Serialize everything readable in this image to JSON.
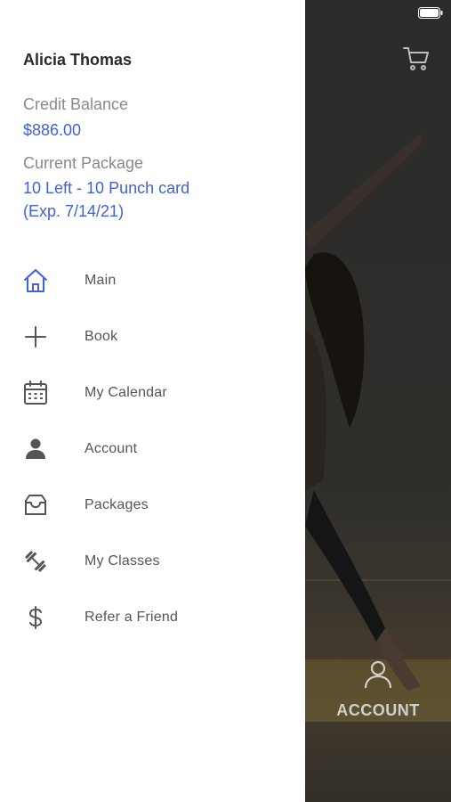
{
  "drawer": {
    "user_name": "Alicia Thomas",
    "credit_label": "Credit Balance",
    "credit_value": "$886.00",
    "package_label": "Current Package",
    "package_line1": "10 Left - 10 Punch card",
    "package_line2": "(Exp. 7/14/21)",
    "menu": [
      {
        "label": "Main",
        "icon": "home-icon"
      },
      {
        "label": "Book",
        "icon": "plus-icon"
      },
      {
        "label": "My Calendar",
        "icon": "calendar-icon"
      },
      {
        "label": "Account",
        "icon": "person-icon"
      },
      {
        "label": "Packages",
        "icon": "inbox-icon"
      },
      {
        "label": "My Classes",
        "icon": "dumbbell-icon"
      },
      {
        "label": "Refer a Friend",
        "icon": "dollar-icon"
      }
    ]
  },
  "background": {
    "tab_label": "ACCOUNT"
  },
  "colors": {
    "accent": "#3f63d3",
    "muted_text": "#8a8a8a",
    "menu_text": "#555555",
    "overlay": "#2f2d29"
  }
}
